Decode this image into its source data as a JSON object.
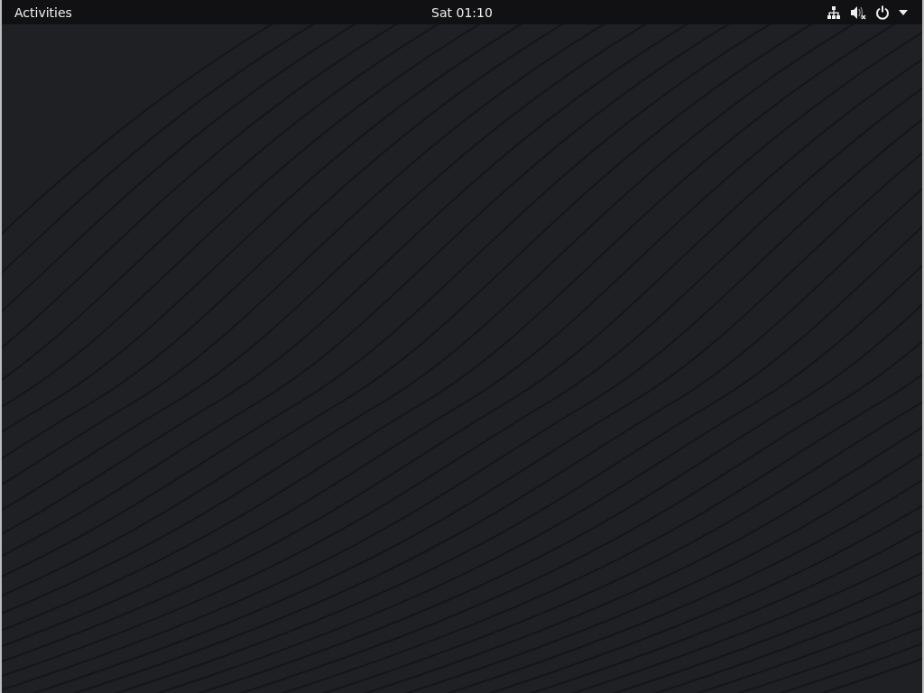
{
  "top_bar": {
    "activities": "Activities",
    "clock": "Sat 01:10"
  }
}
